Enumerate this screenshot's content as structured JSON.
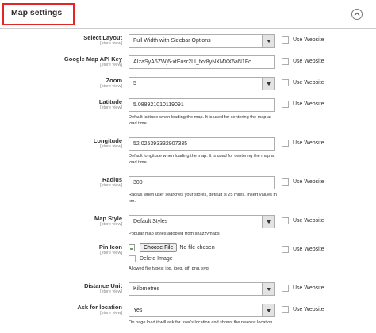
{
  "section": {
    "title": "Map settings"
  },
  "use_website_label": "Use Website",
  "scope_label": "[store view]",
  "fields": {
    "layout": {
      "label": "Select Layout",
      "value": "Full Width with Sidebar Options"
    },
    "api_key": {
      "label": "Google Map API Key",
      "value": "AIzaSyA6ZWj6-xtEosr2LI_fxv8yNXMXX6aN1Fc"
    },
    "zoom": {
      "label": "Zoom",
      "value": "5"
    },
    "latitude": {
      "label": "Latitude",
      "value": "5.088921010119091",
      "note": "Default latitude when loading the map. It is used for centering the map at load time"
    },
    "longitude": {
      "label": "Longitude",
      "value": "52.025393332907335",
      "note": "Default longitude when loading the map. It is used for centering the map at load time"
    },
    "radius": {
      "label": "Radius",
      "value": "300",
      "note": "Radius when user searches your stores, default is 25 miles. Insert values in km."
    },
    "map_style": {
      "label": "Map Style",
      "value": "Default Styles",
      "note": "Popular map styles adopted from snazzymaps"
    },
    "pin_icon": {
      "label": "Pin Icon",
      "button": "Choose File",
      "status": "No file chosen",
      "delete_label": "Delete Image",
      "note": "Allowed file types: jpg, jpeg, gif, png, svg."
    },
    "distance_unit": {
      "label": "Distance Unit",
      "value": "Kilometres"
    },
    "ask_location": {
      "label": "Ask for location",
      "value": "Yes",
      "note": "On page load it will ask for user's location and shows the nearest location."
    }
  },
  "colors": {
    "highlight_border": "#e22626",
    "select_arrow_bg": "#e3e3e3"
  },
  "icons": {
    "collapse": "chevron-up-circle-icon",
    "broken_image": "broken-image-icon"
  }
}
